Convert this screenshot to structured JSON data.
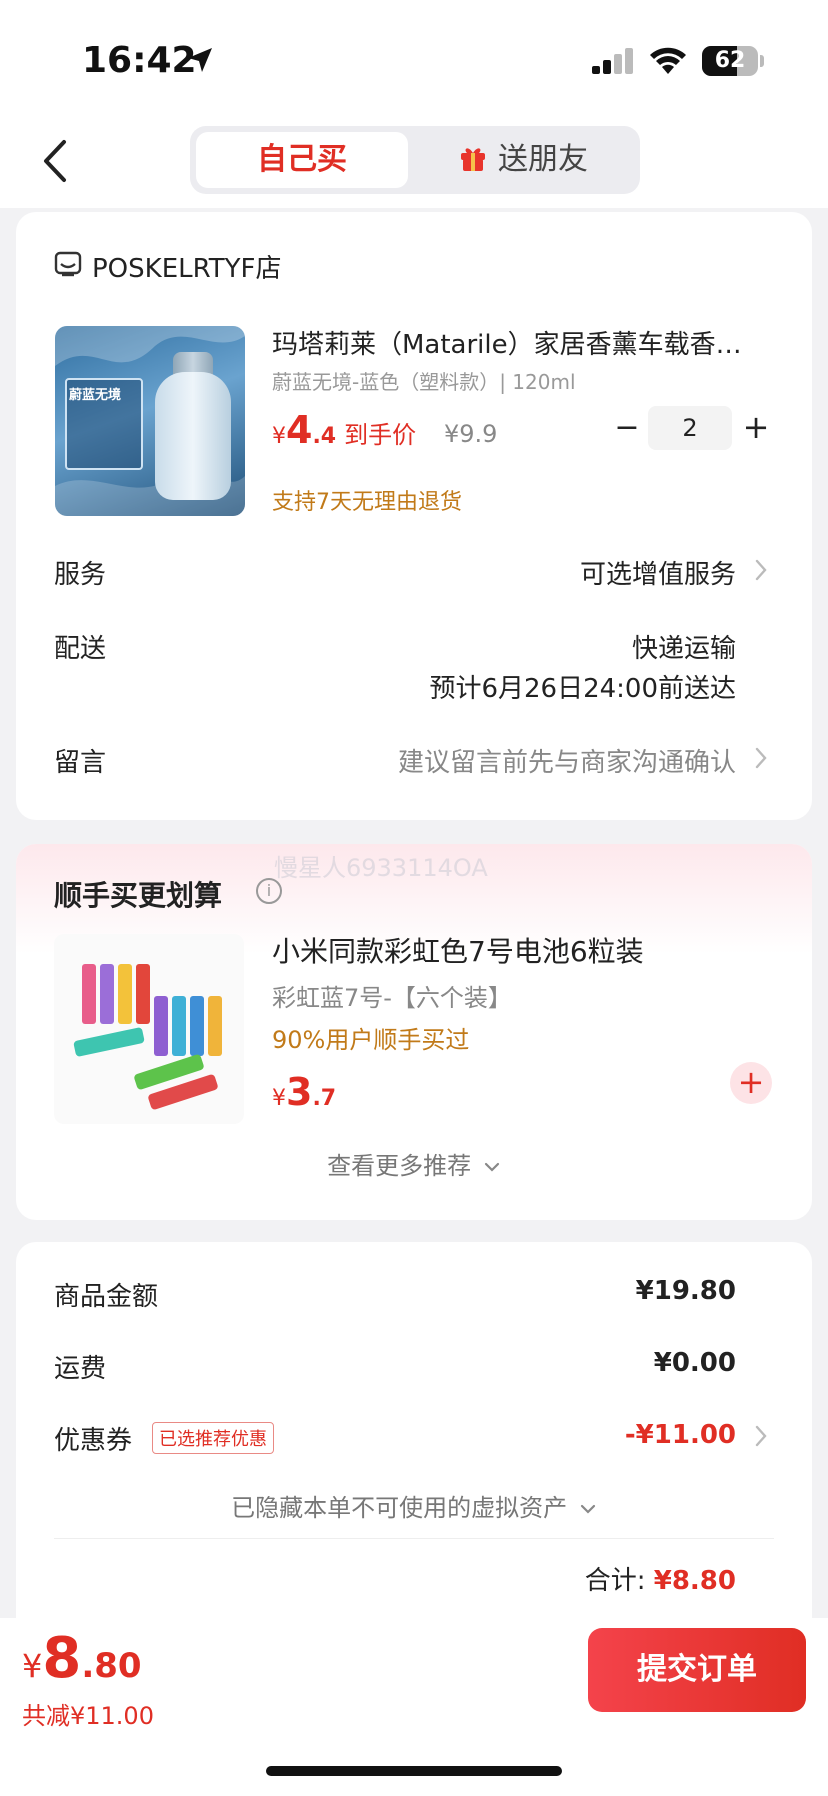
{
  "status_bar": {
    "time": "16:42",
    "battery": "62",
    "battery_level": 0.62
  },
  "nav": {
    "tab_self": "自己买",
    "tab_friend": "送朋友"
  },
  "shop": {
    "name": "POSKELRTYF店"
  },
  "product": {
    "title": "玛塔莉莱（Matarile）家居香薰车载香…",
    "spec": "蔚蓝无境-蓝色（塑料款）| 120ml",
    "currency": "¥",
    "price_int": "4",
    "price_dec": ".4",
    "price_label": "到手价",
    "original_price": "¥9.9",
    "quantity": "2",
    "qty_minus": "−",
    "qty_plus": "+",
    "return_policy": "支持7天无理由退货",
    "image_text": "蔚蓝无境"
  },
  "rows": {
    "service_label": "服务",
    "service_value": "可选增值服务",
    "delivery_label": "配送",
    "delivery_method": "快递运输",
    "delivery_eta": "预计6月26日24:00前送达",
    "note_label": "留言",
    "note_placeholder": "建议留言前先与商家沟通确认"
  },
  "recommend": {
    "watermark": "慢星人6933114OA",
    "title": "顺手买更划算",
    "info": "i",
    "name": "小米同款彩虹色7号电池6粒装",
    "spec": "彩虹蓝7号-【六个装】",
    "bought_pct": "90%用户顺手买过",
    "currency": "¥",
    "price_int": "3",
    "price_dec": ".7",
    "add": "+",
    "more": "查看更多推荐"
  },
  "summary": {
    "goods_label": "商品金额",
    "goods_value": "¥19.80",
    "shipping_label": "运费",
    "shipping_value": "¥0.00",
    "coupon_label": "优惠券",
    "coupon_tag": "已选推荐优惠",
    "coupon_value": "-¥11.00",
    "hidden_assets": "已隐藏本单不可使用的虚拟资产",
    "total_label": "合计:",
    "total_value": "¥8.80"
  },
  "bottom": {
    "currency": "¥",
    "price_int": "8",
    "price_dec": ".80",
    "saved": "共减¥11.00",
    "submit": "提交订单"
  },
  "colors": {
    "accent": "#e02e24",
    "orange": "#c17a19",
    "background": "#f2f2f4"
  },
  "icons": [
    "location-arrow-icon",
    "signal-icon",
    "wifi-icon",
    "battery-icon",
    "back-arrow-icon",
    "gift-icon",
    "shop-icon",
    "chevron-right-icon",
    "info-icon",
    "chevron-down-icon",
    "plus-icon"
  ]
}
